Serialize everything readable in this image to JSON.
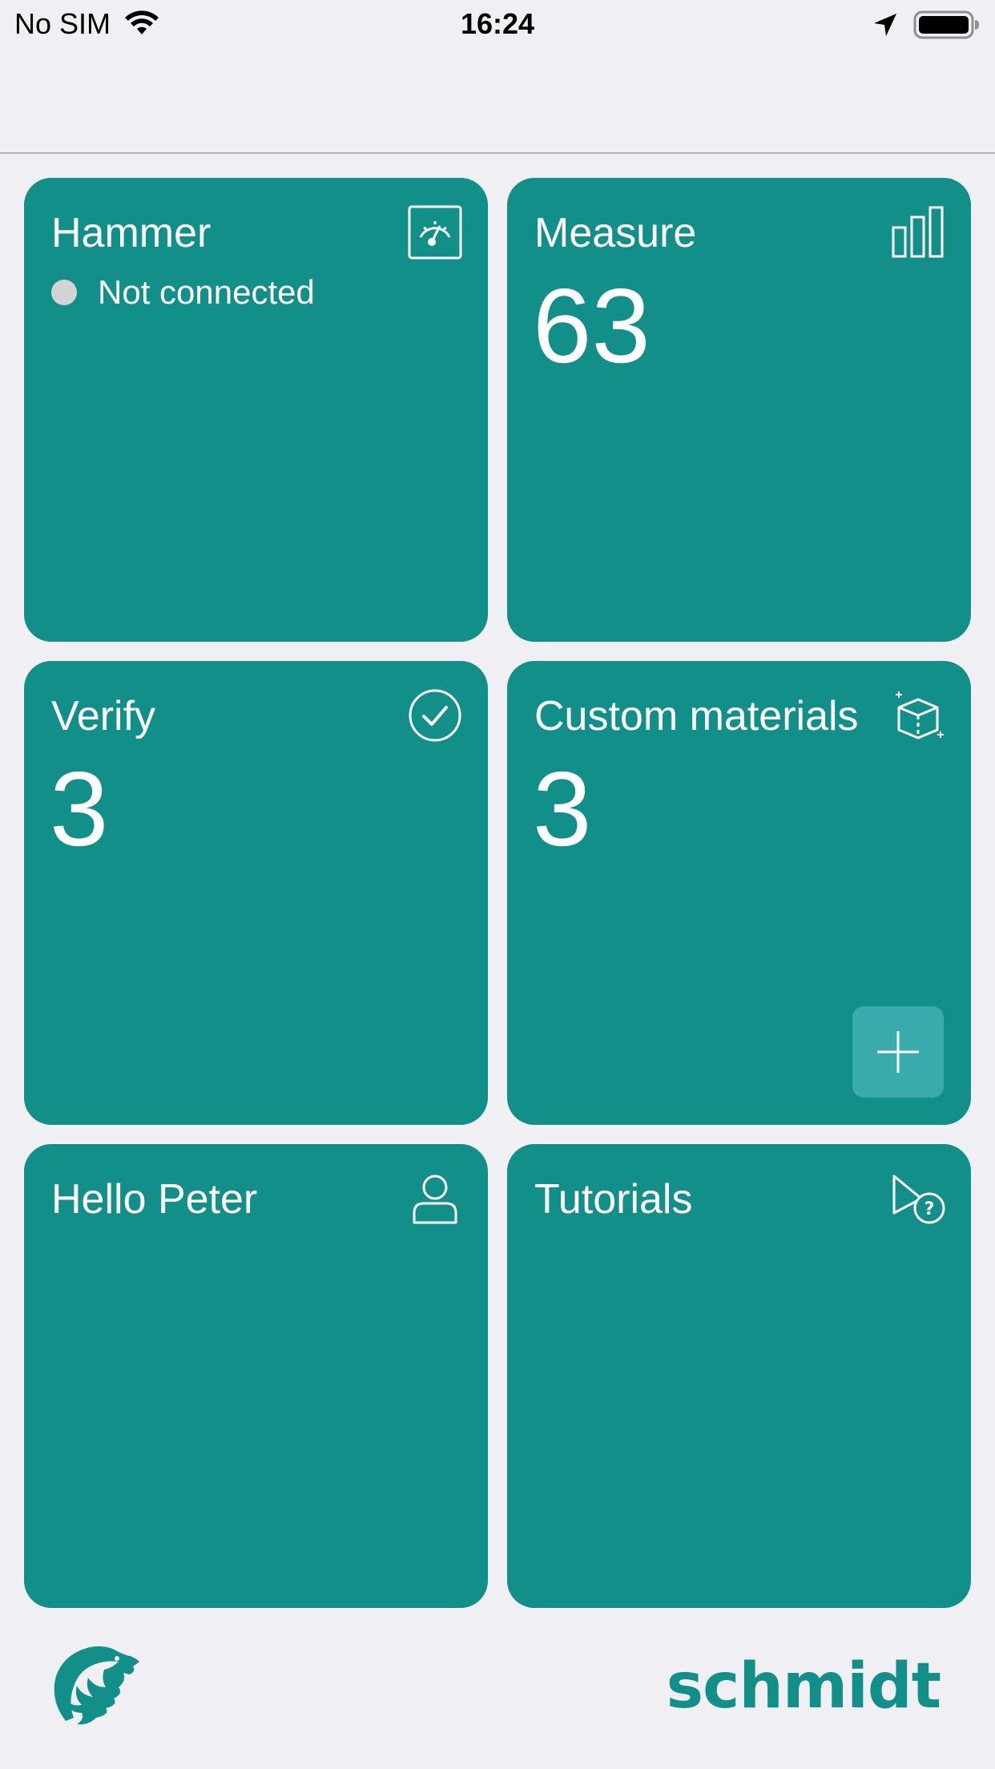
{
  "status_bar": {
    "carrier": "No SIM",
    "time": "16:24"
  },
  "tiles": {
    "hammer": {
      "title": "Hammer",
      "status": "Not connected",
      "icon": "gauge-icon"
    },
    "measure": {
      "title": "Measure",
      "count": "63",
      "icon": "bar-chart-icon"
    },
    "verify": {
      "title": "Verify",
      "count": "3",
      "icon": "check-circle-icon"
    },
    "custom_materials": {
      "title": "Custom materials",
      "count": "3",
      "icon": "cube-icon",
      "add_icon": "plus-icon"
    },
    "user": {
      "title": "Hello Peter",
      "icon": "person-icon"
    },
    "tutorials": {
      "title": "Tutorials",
      "icon": "play-help-icon"
    }
  },
  "footer": {
    "brand": "schmidt",
    "logo_icon": "eagle-logo"
  },
  "colors": {
    "tile": "#138f8a",
    "add_button": "#3aabad",
    "background": "#efeff4",
    "status_dot": "#d4d4d4"
  }
}
